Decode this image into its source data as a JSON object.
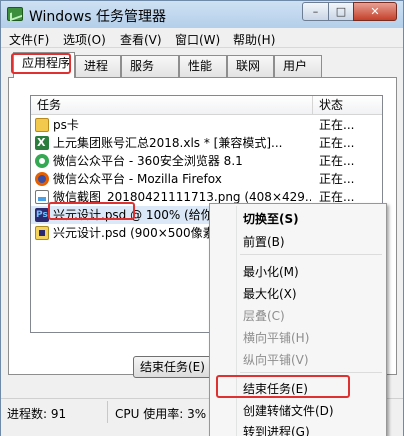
{
  "window": {
    "title": "Windows 任务管理器",
    "controls": {
      "minimize": "–",
      "maximize": "□",
      "close": "✕"
    }
  },
  "menubar": {
    "items": [
      "文件(F)",
      "选项(O)",
      "查看(V)",
      "窗口(W)",
      "帮助(H)"
    ]
  },
  "tabs": [
    {
      "label": "应用程序",
      "active": true
    },
    {
      "label": "进程"
    },
    {
      "label": "服务"
    },
    {
      "label": "性能"
    },
    {
      "label": "联网"
    },
    {
      "label": "用户"
    }
  ],
  "task_list": {
    "columns": {
      "task": "任务",
      "status": "状态"
    },
    "rows": [
      {
        "icon": "folder-icon",
        "name": "ps卡",
        "status": "正在..."
      },
      {
        "icon": "excel-icon",
        "name": "上元集团账号汇总2018.xls * [兼容模式]...",
        "status": "正在..."
      },
      {
        "icon": "browser-360-icon",
        "name": "微信公众平台 - 360安全浏览器 8.1",
        "status": "正在..."
      },
      {
        "icon": "firefox-icon",
        "name": "微信公众平台 - Mozilla Firefox",
        "status": "正在..."
      },
      {
        "icon": "picture-icon",
        "name": "微信截图_20180421111713.png (408×429...",
        "status": "正在..."
      },
      {
        "icon": "photoshop-icon",
        "name": "兴元设计.psd @ 100% (给你设",
        "status": "",
        "selected": true
      },
      {
        "icon": "photoshop-doc-icon",
        "name": "兴元设计.psd (900×500像素",
        "status": ""
      }
    ]
  },
  "buttons": {
    "end_task": "结束任务(E)"
  },
  "statusbar": {
    "processes": "进程数: 91",
    "cpu": "CPU 使用率: 3%"
  },
  "context_menu": {
    "items": [
      {
        "label": "切换至(S)",
        "bold": true
      },
      {
        "label": "前置(B)"
      },
      {
        "separator": true
      },
      {
        "label": "最小化(M)"
      },
      {
        "label": "最大化(X)"
      },
      {
        "label": "层叠(C)",
        "disabled": true
      },
      {
        "label": "横向平铺(H)",
        "disabled": true
      },
      {
        "label": "纵向平铺(V)",
        "disabled": true
      },
      {
        "separator": true
      },
      {
        "label": "结束任务(E)"
      },
      {
        "label": "创建转储文件(D)"
      },
      {
        "label": "转到进程(G)"
      }
    ]
  },
  "colors": {
    "highlight_box": "#e03131",
    "selection": "#dbe8f7",
    "window_frame": "#a9c6e3"
  }
}
